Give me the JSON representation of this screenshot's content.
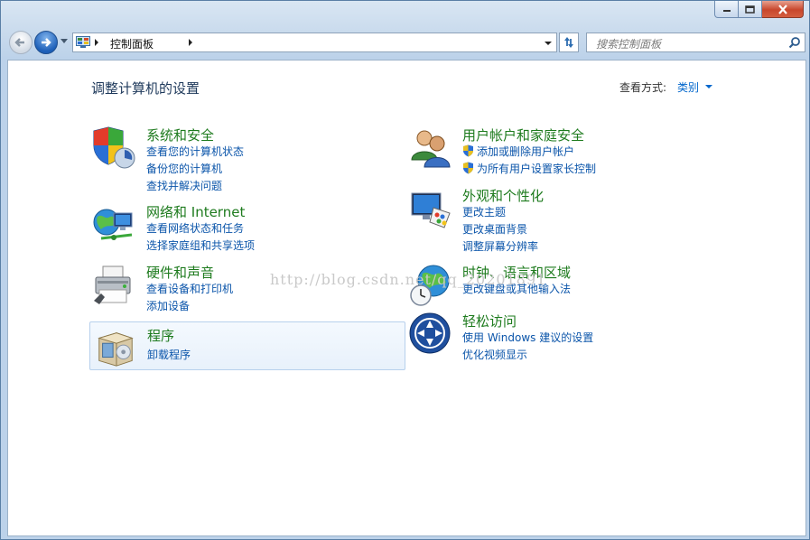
{
  "window": {
    "caption_buttons": [
      "minimize",
      "maximize",
      "close"
    ]
  },
  "address_bar": {
    "breadcrumb": "控制面板",
    "search_placeholder": "搜索控制面板"
  },
  "main": {
    "page_title": "调整计算机的设置",
    "view_by_label": "查看方式:",
    "view_by_value": "类别"
  },
  "categories": [
    {
      "title": "系统和安全",
      "icon": "shield-computer-icon",
      "links": [
        "查看您的计算机状态",
        "备份您的计算机",
        "查找并解决问题"
      ]
    },
    {
      "title": "网络和 Internet",
      "icon": "network-globe-icon",
      "links": [
        "查看网络状态和任务",
        "选择家庭组和共享选项"
      ]
    },
    {
      "title": "硬件和声音",
      "icon": "printer-icon",
      "links": [
        "查看设备和打印机",
        "添加设备"
      ]
    },
    {
      "title": "程序",
      "icon": "programs-box-icon",
      "links": [
        "卸载程序"
      ]
    },
    {
      "title": "用户帐户和家庭安全",
      "icon": "users-icon",
      "links": [
        "添加或删除用户帐户",
        "为所有用户设置家长控制"
      ]
    },
    {
      "title": "外观和个性化",
      "icon": "monitor-palette-icon",
      "links": [
        "更改主题",
        "更改桌面背景",
        "调整屏幕分辨率"
      ]
    },
    {
      "title": "时钟、语言和区域",
      "icon": "globe-clock-icon",
      "links": [
        "更改键盘或其他输入法"
      ]
    },
    {
      "title": "轻松访问",
      "icon": "ease-of-access-icon",
      "links": [
        "使用 Windows 建议的设置",
        "优化视频显示"
      ]
    }
  ],
  "watermark": "http://blog.csdn.net/qq_20201891",
  "colors": {
    "category_title": "#1e7b1e",
    "link": "#0b55aa",
    "heading": "#1e395b"
  }
}
